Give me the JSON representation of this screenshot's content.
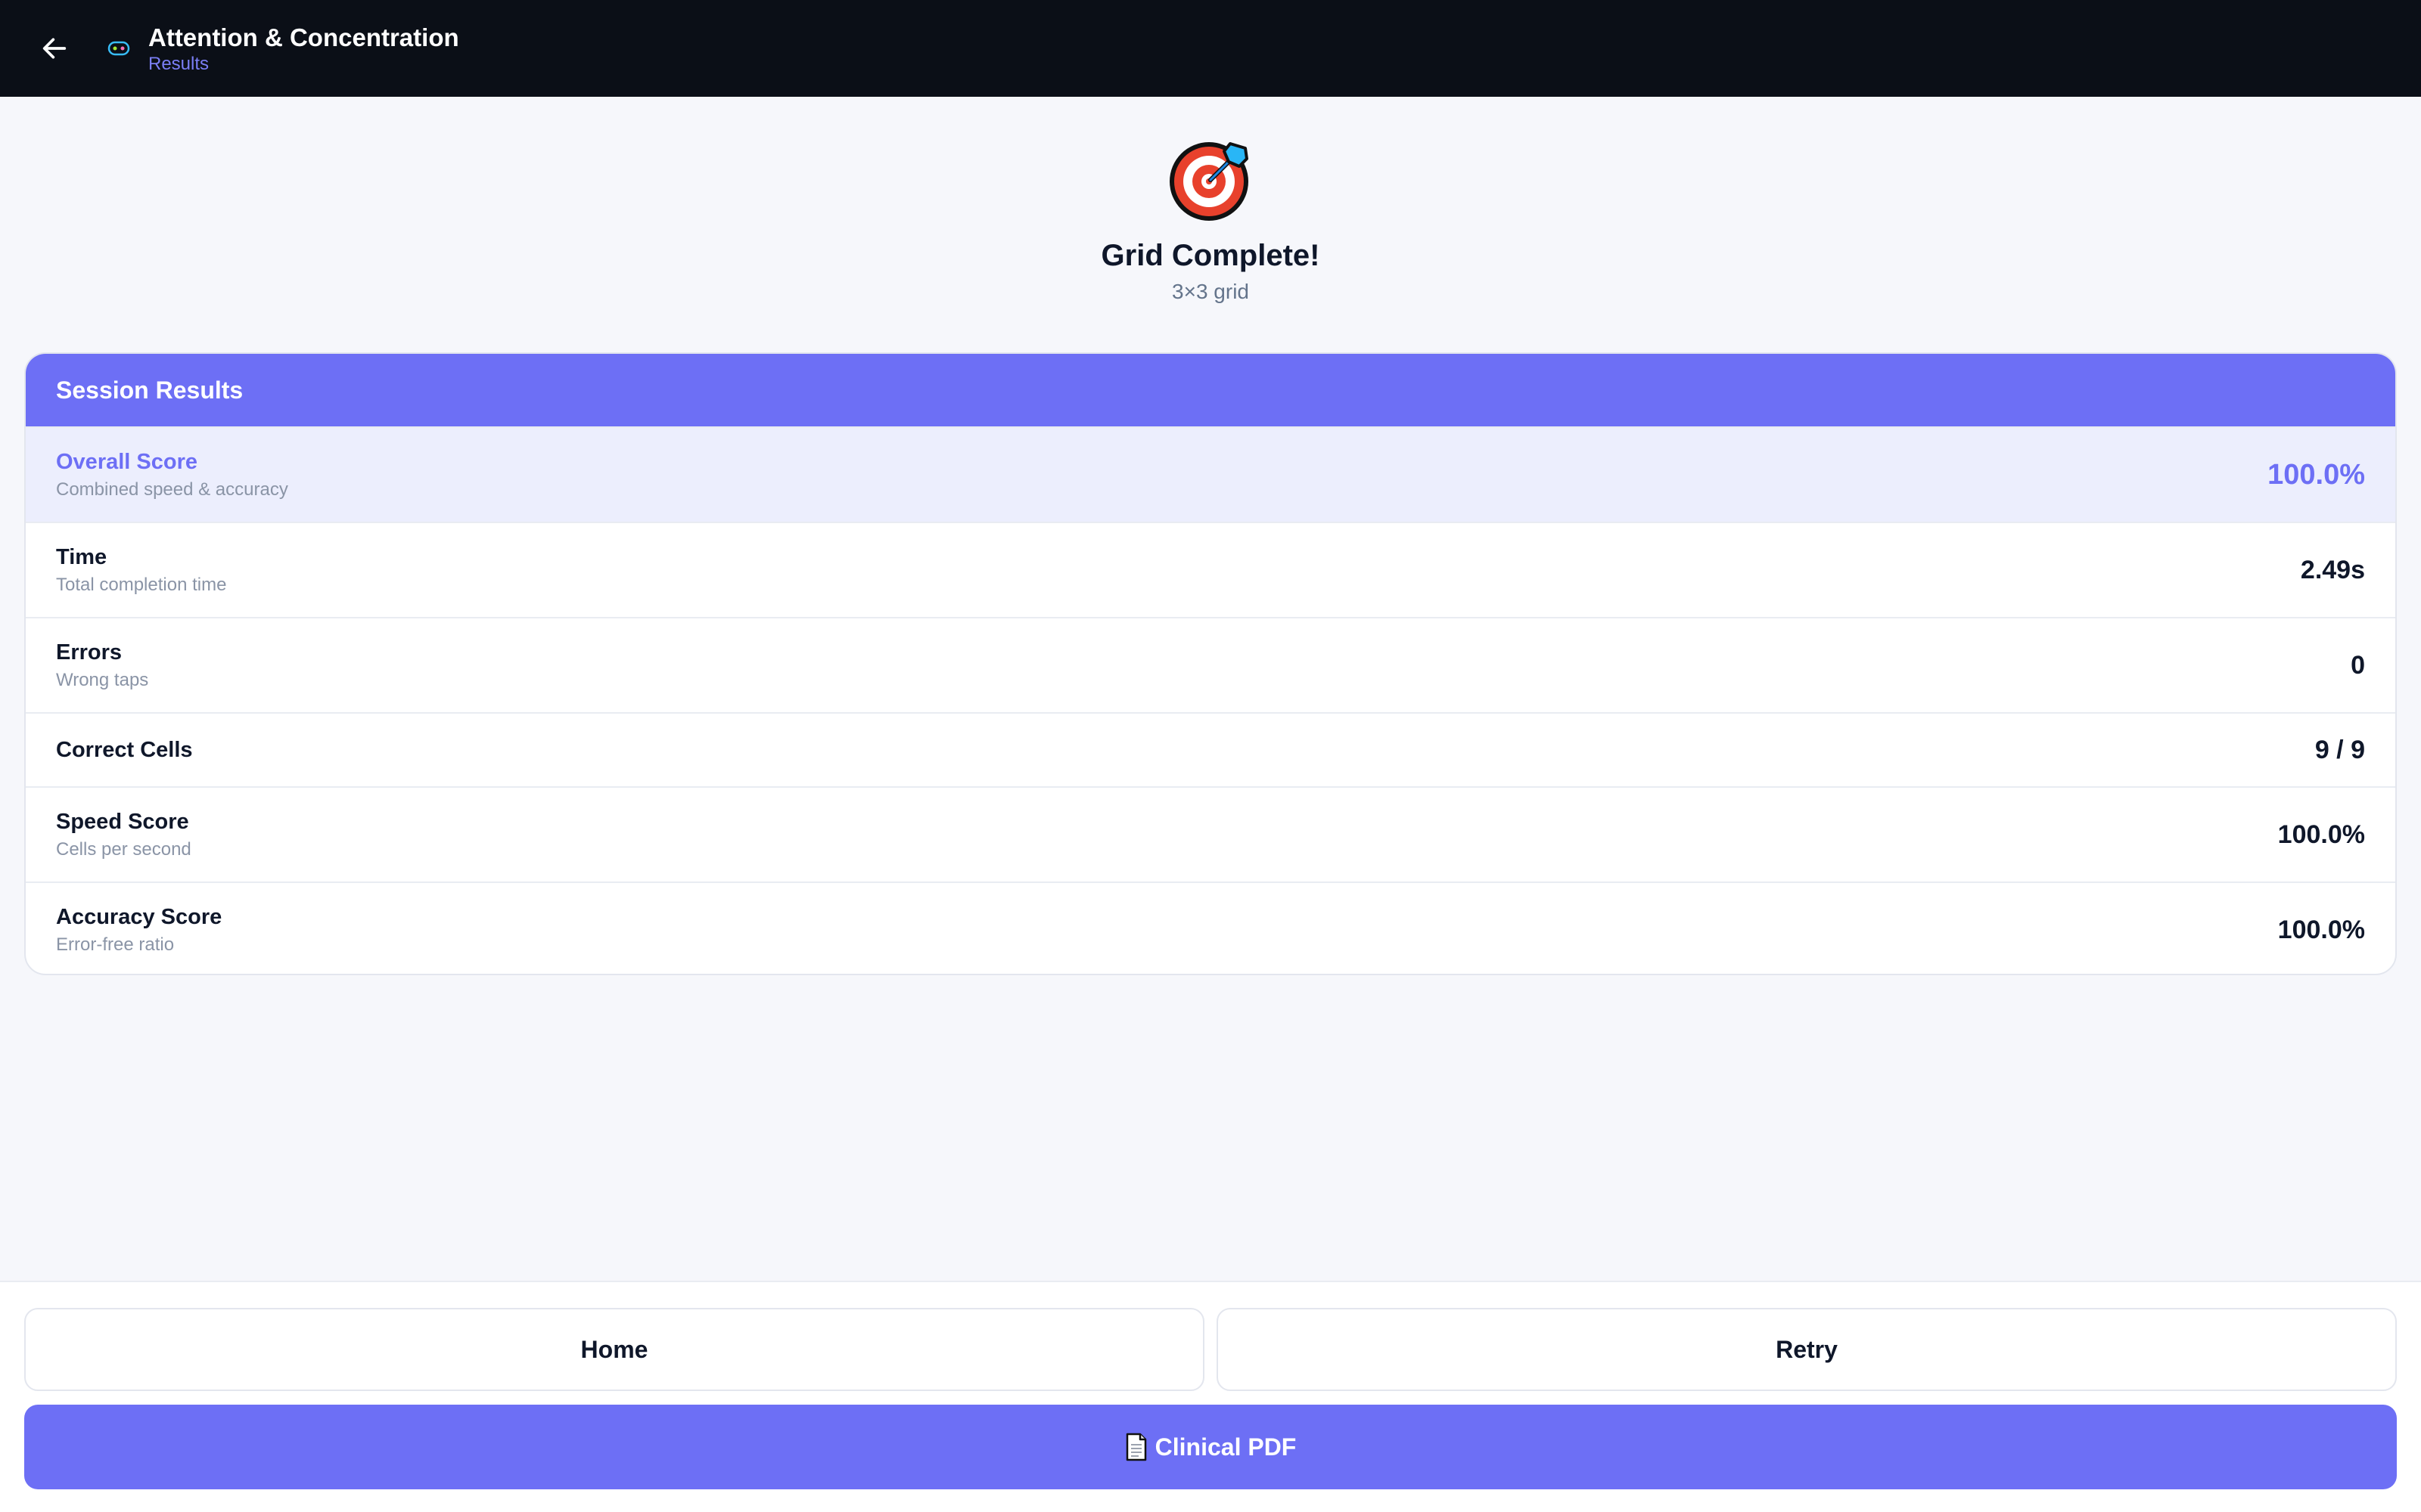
{
  "header": {
    "title": "Attention & Concentration",
    "subtitle": "Results"
  },
  "hero": {
    "icon": "target-dart-icon",
    "title": "Grid Complete!",
    "subtitle": "3×3 grid"
  },
  "results": {
    "heading": "Session Results",
    "rows": [
      {
        "label": "Overall Score",
        "desc": "Combined speed & accuracy",
        "value": "100.0%"
      },
      {
        "label": "Time",
        "desc": "Total completion time",
        "value": "2.49s"
      },
      {
        "label": "Errors",
        "desc": "Wrong taps",
        "value": "0"
      },
      {
        "label": "Correct Cells",
        "desc": "",
        "value": "9 / 9"
      },
      {
        "label": "Speed Score",
        "desc": "Cells per second",
        "value": "100.0%"
      },
      {
        "label": "Accuracy Score",
        "desc": "Error-free ratio",
        "value": "100.0%"
      }
    ]
  },
  "actions": {
    "home_label": "Home",
    "retry_label": "Retry",
    "pdf_label": "Clinical PDF"
  },
  "colors": {
    "accent": "#6d6ff5",
    "topbar": "#0b0f17",
    "background": "#f6f7fb"
  }
}
